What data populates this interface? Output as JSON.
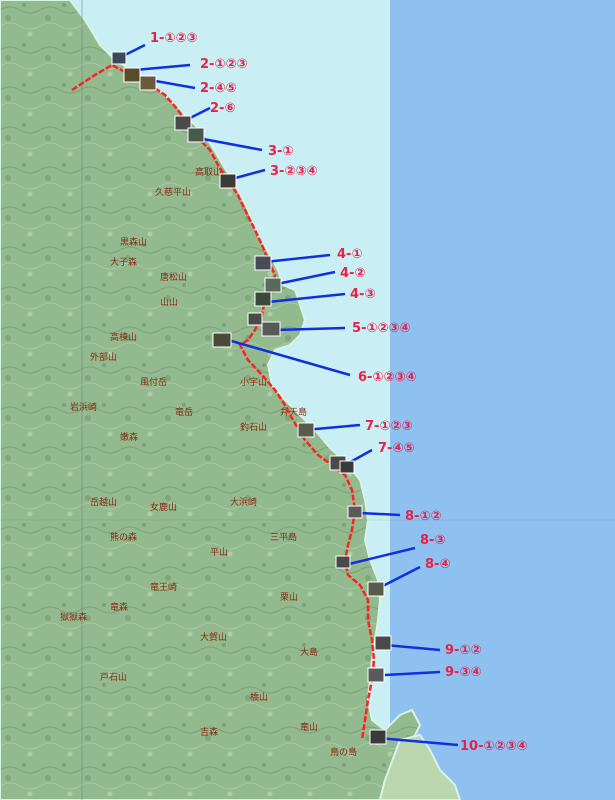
{
  "colors": {
    "sea": "#8fc1f0",
    "coast_water": "#c9eef3",
    "land": "#8fb58a",
    "route": "#ff2020",
    "leader": "#1030e0",
    "label": "#e8204a"
  },
  "labels": [
    {
      "id": "1",
      "text": "1-①②③"
    },
    {
      "id": "2a",
      "text": "2-①②③"
    },
    {
      "id": "2b",
      "text": "2-④⑤"
    },
    {
      "id": "2c",
      "text": "2-⑥"
    },
    {
      "id": "3a",
      "text": "3-①"
    },
    {
      "id": "3b",
      "text": "3-②③④"
    },
    {
      "id": "4a",
      "text": "4-①"
    },
    {
      "id": "4b",
      "text": "4-②"
    },
    {
      "id": "4c",
      "text": "4-③"
    },
    {
      "id": "5",
      "text": "5-①②③④"
    },
    {
      "id": "6",
      "text": "6-①②③④"
    },
    {
      "id": "7a",
      "text": "7-①②③"
    },
    {
      "id": "7b",
      "text": "7-④⑤"
    },
    {
      "id": "8a",
      "text": "8-①②"
    },
    {
      "id": "8b",
      "text": "8-③"
    },
    {
      "id": "8c",
      "text": "8-④"
    },
    {
      "id": "9a",
      "text": "9-①②"
    },
    {
      "id": "9b",
      "text": "9-③④"
    },
    {
      "id": "10",
      "text": "10-①②③④"
    }
  ],
  "places": [
    "高取山",
    "久慈平山",
    "黒森山",
    "大子森",
    "唐松山",
    "山山",
    "高棟山",
    "風付岳",
    "小宇山",
    "竜岳",
    "岩浜崎",
    "嫩森",
    "外部山",
    "釣石山",
    "弁天島",
    "岳越山",
    "女鹿山",
    "大浜崎",
    "熊の森",
    "平山",
    "三平島",
    "竜王崎",
    "獄獄森",
    "竜森",
    "大賀山",
    "栗山",
    "大島",
    "戸石山",
    "橋山",
    "鳥の島",
    "吉森",
    "竜山"
  ]
}
